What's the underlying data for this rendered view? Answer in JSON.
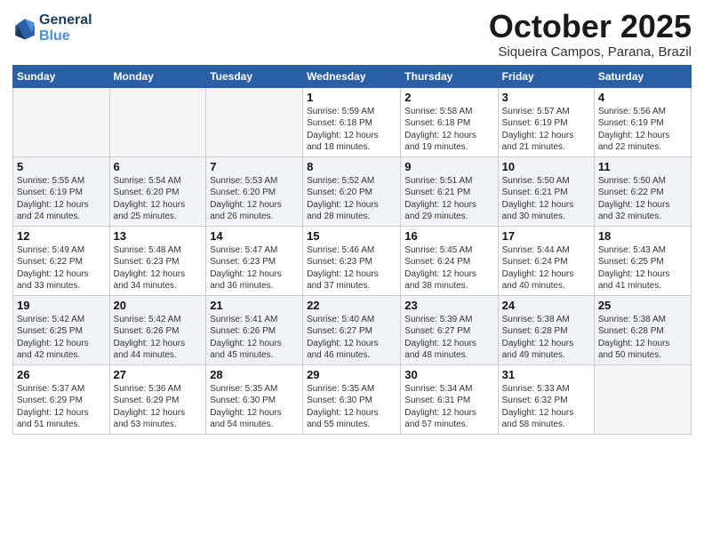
{
  "header": {
    "logo_line1": "General",
    "logo_line2": "Blue",
    "month": "October 2025",
    "location": "Siqueira Campos, Parana, Brazil"
  },
  "days_of_week": [
    "Sunday",
    "Monday",
    "Tuesday",
    "Wednesday",
    "Thursday",
    "Friday",
    "Saturday"
  ],
  "weeks": [
    [
      {
        "day": "",
        "info": ""
      },
      {
        "day": "",
        "info": ""
      },
      {
        "day": "",
        "info": ""
      },
      {
        "day": "1",
        "info": "Sunrise: 5:59 AM\nSunset: 6:18 PM\nDaylight: 12 hours\nand 18 minutes."
      },
      {
        "day": "2",
        "info": "Sunrise: 5:58 AM\nSunset: 6:18 PM\nDaylight: 12 hours\nand 19 minutes."
      },
      {
        "day": "3",
        "info": "Sunrise: 5:57 AM\nSunset: 6:19 PM\nDaylight: 12 hours\nand 21 minutes."
      },
      {
        "day": "4",
        "info": "Sunrise: 5:56 AM\nSunset: 6:19 PM\nDaylight: 12 hours\nand 22 minutes."
      }
    ],
    [
      {
        "day": "5",
        "info": "Sunrise: 5:55 AM\nSunset: 6:19 PM\nDaylight: 12 hours\nand 24 minutes."
      },
      {
        "day": "6",
        "info": "Sunrise: 5:54 AM\nSunset: 6:20 PM\nDaylight: 12 hours\nand 25 minutes."
      },
      {
        "day": "7",
        "info": "Sunrise: 5:53 AM\nSunset: 6:20 PM\nDaylight: 12 hours\nand 26 minutes."
      },
      {
        "day": "8",
        "info": "Sunrise: 5:52 AM\nSunset: 6:20 PM\nDaylight: 12 hours\nand 28 minutes."
      },
      {
        "day": "9",
        "info": "Sunrise: 5:51 AM\nSunset: 6:21 PM\nDaylight: 12 hours\nand 29 minutes."
      },
      {
        "day": "10",
        "info": "Sunrise: 5:50 AM\nSunset: 6:21 PM\nDaylight: 12 hours\nand 30 minutes."
      },
      {
        "day": "11",
        "info": "Sunrise: 5:50 AM\nSunset: 6:22 PM\nDaylight: 12 hours\nand 32 minutes."
      }
    ],
    [
      {
        "day": "12",
        "info": "Sunrise: 5:49 AM\nSunset: 6:22 PM\nDaylight: 12 hours\nand 33 minutes."
      },
      {
        "day": "13",
        "info": "Sunrise: 5:48 AM\nSunset: 6:23 PM\nDaylight: 12 hours\nand 34 minutes."
      },
      {
        "day": "14",
        "info": "Sunrise: 5:47 AM\nSunset: 6:23 PM\nDaylight: 12 hours\nand 36 minutes."
      },
      {
        "day": "15",
        "info": "Sunrise: 5:46 AM\nSunset: 6:23 PM\nDaylight: 12 hours\nand 37 minutes."
      },
      {
        "day": "16",
        "info": "Sunrise: 5:45 AM\nSunset: 6:24 PM\nDaylight: 12 hours\nand 38 minutes."
      },
      {
        "day": "17",
        "info": "Sunrise: 5:44 AM\nSunset: 6:24 PM\nDaylight: 12 hours\nand 40 minutes."
      },
      {
        "day": "18",
        "info": "Sunrise: 5:43 AM\nSunset: 6:25 PM\nDaylight: 12 hours\nand 41 minutes."
      }
    ],
    [
      {
        "day": "19",
        "info": "Sunrise: 5:42 AM\nSunset: 6:25 PM\nDaylight: 12 hours\nand 42 minutes."
      },
      {
        "day": "20",
        "info": "Sunrise: 5:42 AM\nSunset: 6:26 PM\nDaylight: 12 hours\nand 44 minutes."
      },
      {
        "day": "21",
        "info": "Sunrise: 5:41 AM\nSunset: 6:26 PM\nDaylight: 12 hours\nand 45 minutes."
      },
      {
        "day": "22",
        "info": "Sunrise: 5:40 AM\nSunset: 6:27 PM\nDaylight: 12 hours\nand 46 minutes."
      },
      {
        "day": "23",
        "info": "Sunrise: 5:39 AM\nSunset: 6:27 PM\nDaylight: 12 hours\nand 48 minutes."
      },
      {
        "day": "24",
        "info": "Sunrise: 5:38 AM\nSunset: 6:28 PM\nDaylight: 12 hours\nand 49 minutes."
      },
      {
        "day": "25",
        "info": "Sunrise: 5:38 AM\nSunset: 6:28 PM\nDaylight: 12 hours\nand 50 minutes."
      }
    ],
    [
      {
        "day": "26",
        "info": "Sunrise: 5:37 AM\nSunset: 6:29 PM\nDaylight: 12 hours\nand 51 minutes."
      },
      {
        "day": "27",
        "info": "Sunrise: 5:36 AM\nSunset: 6:29 PM\nDaylight: 12 hours\nand 53 minutes."
      },
      {
        "day": "28",
        "info": "Sunrise: 5:35 AM\nSunset: 6:30 PM\nDaylight: 12 hours\nand 54 minutes."
      },
      {
        "day": "29",
        "info": "Sunrise: 5:35 AM\nSunset: 6:30 PM\nDaylight: 12 hours\nand 55 minutes."
      },
      {
        "day": "30",
        "info": "Sunrise: 5:34 AM\nSunset: 6:31 PM\nDaylight: 12 hours\nand 57 minutes."
      },
      {
        "day": "31",
        "info": "Sunrise: 5:33 AM\nSunset: 6:32 PM\nDaylight: 12 hours\nand 58 minutes."
      },
      {
        "day": "",
        "info": ""
      }
    ]
  ]
}
